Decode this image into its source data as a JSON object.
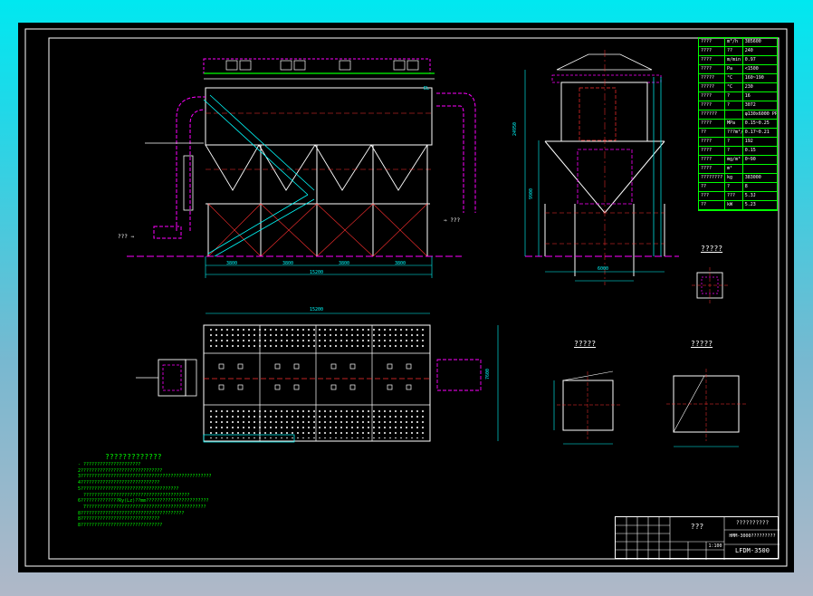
{
  "drawing": {
    "spec_table": [
      [
        "????",
        "m³/h",
        "385600"
      ],
      [
        "????",
        "??",
        "240"
      ],
      [
        "????",
        "m/min",
        "0.97"
      ],
      [
        "????",
        "Pa",
        "<1500"
      ],
      [
        "?????",
        "°C",
        "160~190"
      ],
      [
        "?????",
        "°C",
        "230"
      ],
      [
        "????",
        "?",
        "16"
      ],
      [
        "????",
        "?",
        "3072"
      ],
      [
        "??????",
        "",
        "φ130x6000 PPS"
      ],
      [
        "????",
        "MPa",
        "0.15~0.25"
      ],
      [
        "??",
        "???m³/?",
        "0.17~0.21"
      ],
      [
        "????",
        "?",
        "192"
      ],
      [
        "????",
        "?",
        "0.15"
      ],
      [
        "????",
        "mg/m³",
        "0~90"
      ],
      [
        "????",
        "m²",
        ""
      ],
      [
        "????????",
        "kg",
        "383000"
      ],
      [
        "??",
        "?",
        "8"
      ],
      [
        "???",
        "???",
        "5.3J"
      ],
      [
        "??",
        "kW",
        "5.23"
      ]
    ],
    "labels": {
      "detail_a": "?????",
      "detail_b": "?????",
      "detail_c": "?????",
      "notes_title": "?????????????",
      "inlet_label": "??? ⇒",
      "marker_label": "⇒ ???"
    },
    "notes": [
      "- ?????????????????????",
      "2??????????????????????????????",
      "3????????????????????????????????????????????????",
      "4?????????????????????????????",
      "5????????????????????????????????????",
      "  ???????????????????????????????????????",
      "6??????????????Ry(Lz)??mm???????????????????????",
      "  7????????????????????????????????????????????",
      "8??????????????????????????????????????",
      "8?????????????????????????????",
      "8??????????????????????????????"
    ],
    "title_block": {
      "part_name": "???",
      "company": "??????????",
      "drawing_title": "HMM-3000?????????",
      "drawing_no": "LFDM-3500",
      "scale": "1:100"
    }
  }
}
